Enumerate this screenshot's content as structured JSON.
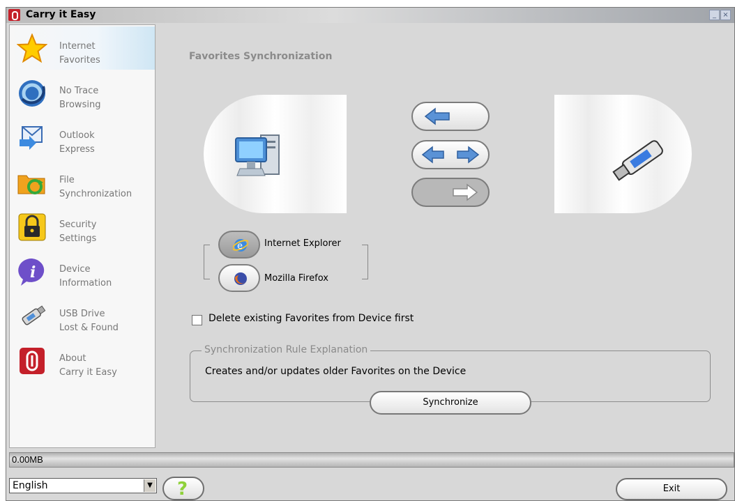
{
  "window": {
    "title": "Carry it Easy",
    "controls": {
      "minimize": "_",
      "close": "×"
    }
  },
  "sidebar": {
    "items": [
      {
        "label": "Internet\nFavorites",
        "icon": "star-icon",
        "active": true
      },
      {
        "label": "No Trace\nBrowsing",
        "icon": "no-trace-icon",
        "active": false
      },
      {
        "label": "Outlook\nExpress",
        "icon": "outlook-icon",
        "active": false
      },
      {
        "label": "File\nSynchronization",
        "icon": "folder-sync-icon",
        "active": false
      },
      {
        "label": "Security\nSettings",
        "icon": "padlock-icon",
        "active": false
      },
      {
        "label": "Device\nInformation",
        "icon": "info-icon",
        "active": false
      },
      {
        "label": "USB Drive\nLost & Found",
        "icon": "usb-drive-icon",
        "active": false
      },
      {
        "label": "About\nCarry it Easy",
        "icon": "app-logo-icon",
        "active": false
      }
    ]
  },
  "main": {
    "section_title": "Favorites Synchronization",
    "sync_direction_options": [
      "device-to-computer",
      "bidirectional",
      "computer-to-device"
    ],
    "browsers": [
      {
        "label": "Internet Explorer",
        "icon": "ie-icon",
        "selected": true
      },
      {
        "label": "Mozilla Firefox",
        "icon": "firefox-icon",
        "selected": false
      }
    ],
    "delete_checkbox": {
      "label": "Delete existing Favorites from Device first",
      "checked": false
    },
    "rule": {
      "legend": "Synchronization Rule Explanation",
      "text": "Creates and/or updates older Favorites on the Device"
    },
    "sync_button_label": "Synchronize"
  },
  "status": {
    "progress_text": "0.00MB"
  },
  "footer": {
    "language": "English",
    "help_label": "?",
    "exit_label": "Exit"
  },
  "colors": {
    "brand_red": "#c4202a",
    "arrow_blue": "#5a92d6",
    "background": "#d8d8d8"
  }
}
